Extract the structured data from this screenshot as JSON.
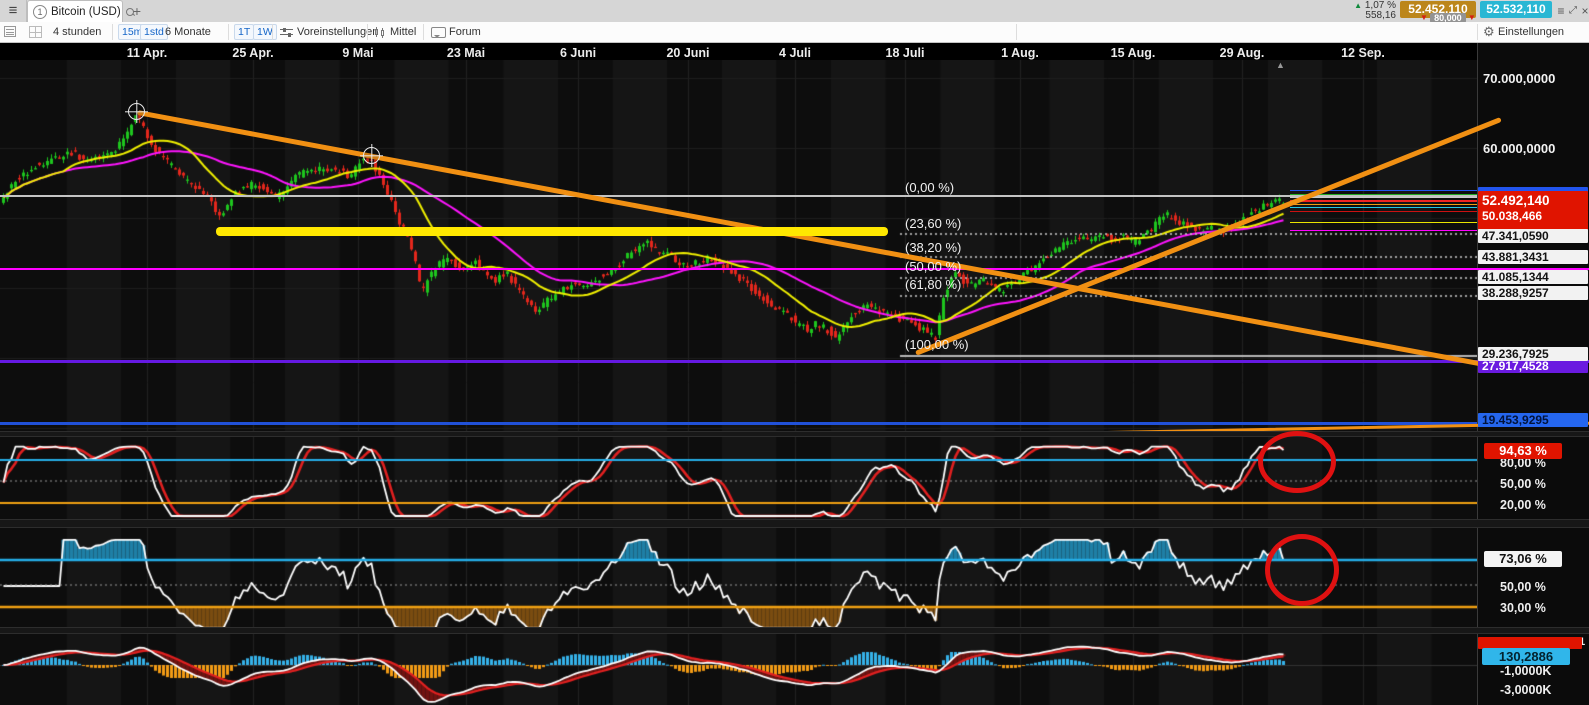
{
  "window": {
    "menu_icon": "≡",
    "tab_number": "1",
    "title": "Bitcoin (USD)",
    "new_tab": "+",
    "change_pct": "1,07 %",
    "change_abs": "558,16",
    "bid": "52.452,110",
    "spread": "80,000",
    "ask": "52.532,110",
    "resize_icon": "⤢",
    "close_icon": "×"
  },
  "toolbar": {
    "interval": "4 stunden",
    "tf_15m": "15m",
    "tf_1std": "1std",
    "range": "6 Monate",
    "tf_1t": "1T",
    "tf_1w": "1W",
    "presets": "Voreinstellungen",
    "mean": "Mittel",
    "forum": "Forum",
    "settings": "Einstellungen"
  },
  "x_axis": {
    "labels": [
      "11 Apr.",
      "25 Apr.",
      "9 Mai",
      "23 Mai",
      "6 Juni",
      "20 Juni",
      "4 Juli",
      "18 Juli",
      "1 Aug.",
      "15 Aug.",
      "29 Aug.",
      "12 Sep."
    ]
  },
  "y_axis": {
    "tick_70k": "70.000,0000",
    "tick_60k": "60.000,0000",
    "last_price": "52.492,140",
    "bid_price": "50.038,466",
    "fib_236_price": "47.341,0590",
    "fib_382_price": "43.881,3431",
    "fib_500_price": "41.085,1344",
    "fib_618_price": "38.288,9257",
    "fib_1000_price": "29.236,7925",
    "purple_level_price": "27.917,4528",
    "blue_level_price": "19.453,9295"
  },
  "fibonacci": {
    "labels": [
      "(0,00 %)",
      "(23,60 %)",
      "(38,20 %)",
      "(50,00 %)",
      "(61,80 %)",
      "(100,00 %)"
    ]
  },
  "stoch_panel": {
    "last": "94,63 %",
    "level_80": "80,00 %",
    "level_50": "50,00 %",
    "level_20": "20,00 %"
  },
  "rsi_panel": {
    "last": "73,06 %",
    "level_50": "50,00 %",
    "level_30": "30,00 %"
  },
  "macd_panel": {
    "last": "130,2886",
    "clipped_tick": "1",
    "level_m1": "-1,0000K",
    "level_m3": "-3,0000K"
  },
  "chart_data": {
    "type": "candlestick",
    "symbol": "Bitcoin (USD)",
    "interval": "4 stunden",
    "visible_range": "6 Monate",
    "x_tick_labels": [
      "11 Apr.",
      "25 Apr.",
      "9 Mai",
      "23 Mai",
      "6 Juni",
      "20 Juni",
      "4 Juli",
      "18 Juli",
      "1 Aug.",
      "15 Aug.",
      "29 Aug.",
      "12 Sep."
    ],
    "y_ticks": [
      70000,
      60000
    ],
    "last_price": 52492.14,
    "price_path": [
      [
        0,
        51857
      ],
      [
        20,
        55714
      ],
      [
        40,
        57571
      ],
      [
        60,
        58571
      ],
      [
        75,
        59286
      ],
      [
        90,
        58286
      ],
      [
        105,
        59000
      ],
      [
        120,
        60000
      ],
      [
        130,
        62286
      ],
      [
        137,
        64857
      ],
      [
        145,
        63143
      ],
      [
        155,
        60429
      ],
      [
        165,
        58571
      ],
      [
        178,
        56857
      ],
      [
        192,
        55143
      ],
      [
        205,
        53714
      ],
      [
        215,
        51857
      ],
      [
        222,
        50000
      ],
      [
        232,
        52571
      ],
      [
        243,
        54000
      ],
      [
        255,
        54857
      ],
      [
        268,
        54000
      ],
      [
        280,
        52857
      ],
      [
        292,
        55000
      ],
      [
        305,
        56571
      ],
      [
        318,
        57143
      ],
      [
        330,
        56714
      ],
      [
        342,
        56857
      ],
      [
        352,
        56000
      ],
      [
        362,
        57857
      ],
      [
        372,
        58571
      ],
      [
        380,
        56571
      ],
      [
        390,
        53714
      ],
      [
        400,
        50000
      ],
      [
        410,
        47143
      ],
      [
        418,
        43714
      ],
      [
        424,
        39000
      ],
      [
        430,
        41429
      ],
      [
        438,
        42857
      ],
      [
        448,
        44286
      ],
      [
        458,
        43429
      ],
      [
        468,
        42571
      ],
      [
        478,
        43714
      ],
      [
        488,
        42286
      ],
      [
        498,
        41143
      ],
      [
        508,
        42286
      ],
      [
        518,
        40286
      ],
      [
        528,
        38571
      ],
      [
        538,
        36857
      ],
      [
        548,
        38000
      ],
      [
        558,
        39000
      ],
      [
        568,
        40000
      ],
      [
        578,
        40714
      ],
      [
        588,
        40000
      ],
      [
        598,
        41000
      ],
      [
        608,
        42143
      ],
      [
        618,
        42857
      ],
      [
        628,
        44429
      ],
      [
        638,
        45429
      ],
      [
        650,
        46286
      ],
      [
        660,
        45429
      ],
      [
        670,
        44714
      ],
      [
        680,
        43857
      ],
      [
        690,
        43000
      ],
      [
        700,
        43714
      ],
      [
        710,
        44286
      ],
      [
        720,
        43571
      ],
      [
        730,
        42571
      ],
      [
        740,
        41571
      ],
      [
        750,
        40571
      ],
      [
        760,
        39286
      ],
      [
        770,
        38000
      ],
      [
        780,
        37143
      ],
      [
        790,
        36143
      ],
      [
        800,
        34714
      ],
      [
        810,
        34000
      ],
      [
        820,
        35000
      ],
      [
        830,
        34000
      ],
      [
        838,
        32857
      ],
      [
        848,
        35143
      ],
      [
        858,
        36571
      ],
      [
        868,
        37429
      ],
      [
        878,
        36857
      ],
      [
        888,
        36286
      ],
      [
        898,
        35857
      ],
      [
        908,
        35286
      ],
      [
        918,
        34571
      ],
      [
        928,
        33800
      ],
      [
        938,
        33000
      ],
      [
        946,
        38571
      ],
      [
        955,
        42286
      ],
      [
        965,
        41143
      ],
      [
        975,
        40286
      ],
      [
        985,
        41286
      ],
      [
        995,
        40143
      ],
      [
        1005,
        39571
      ],
      [
        1015,
        40571
      ],
      [
        1025,
        41714
      ],
      [
        1035,
        42857
      ],
      [
        1045,
        44000
      ],
      [
        1055,
        45143
      ],
      [
        1065,
        46000
      ],
      [
        1075,
        46857
      ],
      [
        1085,
        47429
      ],
      [
        1095,
        46714
      ],
      [
        1105,
        47429
      ],
      [
        1115,
        46857
      ],
      [
        1125,
        47429
      ],
      [
        1135,
        46571
      ],
      [
        1145,
        47143
      ],
      [
        1155,
        48571
      ],
      [
        1165,
        50714
      ],
      [
        1175,
        50000
      ],
      [
        1185,
        49143
      ],
      [
        1195,
        48571
      ],
      [
        1205,
        47857
      ],
      [
        1215,
        48571
      ],
      [
        1225,
        48000
      ],
      [
        1235,
        48857
      ],
      [
        1245,
        49714
      ],
      [
        1255,
        50857
      ],
      [
        1265,
        51714
      ],
      [
        1275,
        52143
      ],
      [
        1285,
        52492
      ]
    ],
    "moving_averages": [
      {
        "name": "fast",
        "color": "#f0f000"
      },
      {
        "name": "slow",
        "color": "#ff14ff"
      }
    ],
    "fibonacci_levels": [
      {
        "pct": 0.0
      },
      {
        "pct": 23.6,
        "price": 47341.059
      },
      {
        "pct": 38.2,
        "price": 43881.3431
      },
      {
        "pct": 50.0,
        "price": 41085.1344
      },
      {
        "pct": 61.8,
        "price": 38288.9257
      },
      {
        "pct": 100.0,
        "price": 29236.7925
      }
    ],
    "horizontal_levels": [
      {
        "name": "magenta-support",
        "color": "#ff00ff"
      },
      {
        "name": "purple-support",
        "color": "#6519e2",
        "price": 27917.4528
      },
      {
        "name": "blue-support",
        "color": "#2151d8",
        "price": 19453.9295
      }
    ],
    "indicators": [
      {
        "name": "stochastic",
        "last": 94.63,
        "levels": [
          80,
          50,
          20
        ],
        "colors": [
          "#ffffff",
          "#e02020"
        ]
      },
      {
        "name": "rsi",
        "last": 73.06,
        "levels": [
          50,
          30
        ],
        "color": "#ffffff"
      },
      {
        "name": "macd",
        "last": 130.2886,
        "axis_labels": [
          -1000,
          -3000
        ],
        "colors": {
          "macd": "#ffffff",
          "signal": "#e02020",
          "hist_pos": "#35b1e8",
          "hist_neg": "#f29b15"
        }
      }
    ],
    "annotations": {
      "down_trendline_color": "#f19013",
      "up_trendline_color": "#f19013",
      "support_bar_color": "#ffe800",
      "highlight_circles": 2,
      "anchor_markers": 2
    }
  }
}
